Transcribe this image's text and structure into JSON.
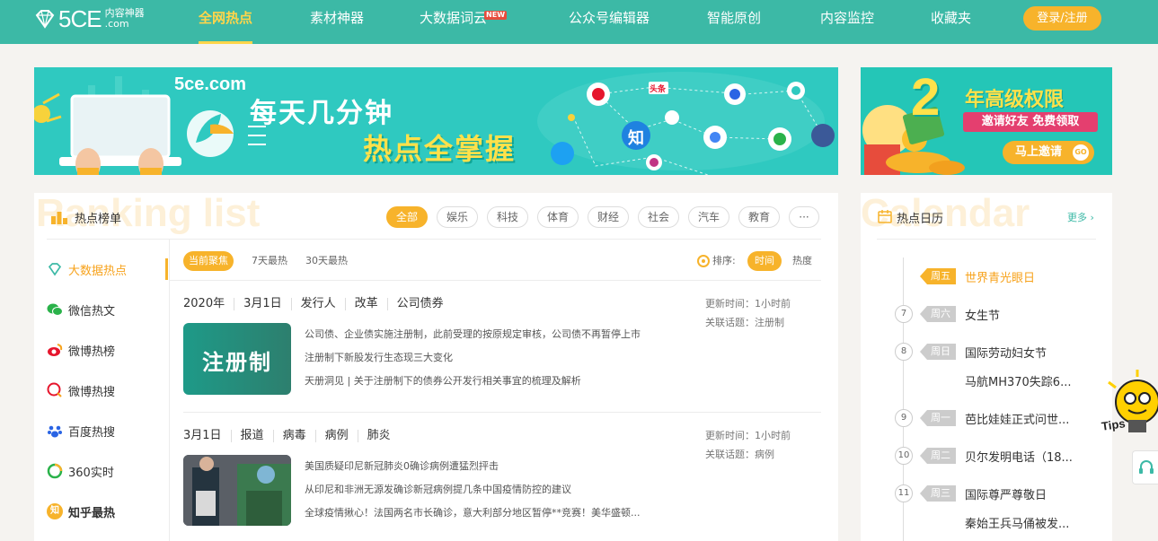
{
  "nav": {
    "logo_text": "5CE",
    "logo_sub1": "内容神器",
    "logo_sub2": ".com",
    "items": [
      {
        "label": "全网热点"
      },
      {
        "label": "素材神器"
      },
      {
        "label": "大数据词云"
      },
      {
        "label": "公众号编辑器"
      },
      {
        "label": "智能原创"
      },
      {
        "label": "内容监控"
      },
      {
        "label": "收藏夹"
      }
    ],
    "new_badge": "NEW",
    "login": "登录/注册"
  },
  "banner_main": {
    "domain": "5ce.com",
    "line1": "每天几分钟",
    "line2": "热点全掌握",
    "toutiao": "头条",
    "zhihu": "知"
  },
  "banner_side": {
    "big_num": "2",
    "line1": "年高级权限",
    "line2": "邀请好友 免费领取",
    "button": "马上邀请",
    "badge": "GO"
  },
  "ranking": {
    "ghost": "Ranking list",
    "title": "热点榜单",
    "categories": [
      "全部",
      "娱乐",
      "科技",
      "体育",
      "财经",
      "社会",
      "汽车",
      "教育"
    ],
    "more_icon": "···",
    "sidebar": [
      "大数据热点",
      "微信热文",
      "微博热榜",
      "微博热搜",
      "百度热搜",
      "360实时",
      "知乎最热"
    ],
    "sidebar_badge": "知",
    "tabs": [
      "当前聚焦",
      "7天最热",
      "30天最热"
    ],
    "sort_label": "排序:",
    "sort_options": [
      "时间",
      "热度"
    ],
    "items": [
      {
        "tags": [
          "2020年",
          "3月1日",
          "发行人",
          "改革",
          "公司债券"
        ],
        "thumb_text": "注册制",
        "updated": "更新时间：1小时前",
        "topic": "关联话题：注册制",
        "lines": [
          "公司债、企业债实施注册制，此前受理的按原规定审核，公司债不再暂停上市",
          "注册制下新股发行生态现三大变化",
          "天册洞见 | 关于注册制下的债券公开发行相关事宜的梳理及解析"
        ]
      },
      {
        "tags": [
          "3月1日",
          "报道",
          "病毒",
          "病例",
          "肺炎"
        ],
        "updated": "更新时间：1小时前",
        "topic": "关联话题：病例",
        "lines": [
          "美国质疑印尼新冠肺炎0确诊病例遭猛烈抨击",
          "从印尼和非洲无源发确诊新冠病例提几条中国疫情防控的建议",
          "全球疫情揪心！法国两名市长确诊，意大利部分地区暂停**竞赛！美华盛顿..."
        ]
      }
    ]
  },
  "calendar": {
    "ghost": "Calendar",
    "title": "热点日历",
    "more": "更多",
    "items": [
      {
        "num": "",
        "day": "周五",
        "event": "世界青光眼日",
        "sub": ""
      },
      {
        "num": "7",
        "day": "周六",
        "event": "女生节",
        "sub": ""
      },
      {
        "num": "8",
        "day": "周日",
        "event": "国际劳动妇女节",
        "sub": "马航MH370失踪6..."
      },
      {
        "num": "9",
        "day": "周一",
        "event": "芭比娃娃正式问世...",
        "sub": ""
      },
      {
        "num": "10",
        "day": "周二",
        "event": "贝尔发明电话（18...",
        "sub": ""
      },
      {
        "num": "11",
        "day": "周三",
        "event": "国际尊严尊敬日",
        "sub": "秦始王兵马俑被发..."
      }
    ]
  },
  "float": {
    "tips": "Tips"
  },
  "colors": {
    "nav": "#3cb9a6",
    "accent": "#f7b32b",
    "banner": "#2fc9c0"
  }
}
